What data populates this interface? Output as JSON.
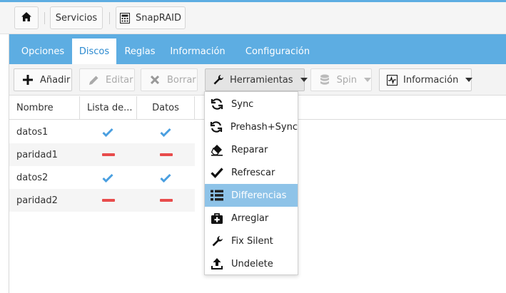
{
  "breadcrumb": {
    "home_icon": "home-icon",
    "items": [
      {
        "label": "Servicios"
      },
      {
        "label": "SnapRAID",
        "icon": "calculator-icon"
      }
    ]
  },
  "tabs": [
    {
      "label": "Opciones",
      "active": false
    },
    {
      "label": "Discos",
      "active": true
    },
    {
      "label": "Reglas",
      "active": false
    },
    {
      "label": "Información",
      "active": false
    },
    {
      "label": "Configuración",
      "active": false
    }
  ],
  "toolbar": {
    "add": {
      "label": "Añadir",
      "icon": "plus-icon",
      "disabled": false
    },
    "edit": {
      "label": "Editar",
      "icon": "pencil-icon",
      "disabled": true
    },
    "delete": {
      "label": "Borrar",
      "icon": "times-icon",
      "disabled": true
    },
    "tools": {
      "label": "Herramientas",
      "icon": "wrench-icon",
      "open": true
    },
    "spin": {
      "label": "Spin",
      "icon": "database-icon",
      "disabled": true
    },
    "info": {
      "label": "Información",
      "icon": "heartbeat-icon",
      "disabled": false
    }
  },
  "table": {
    "columns": [
      "Nombre",
      "Lista de...",
      "Datos"
    ],
    "rows": [
      {
        "name": "datos1",
        "list": true,
        "data": true
      },
      {
        "name": "paridad1",
        "list": false,
        "data": false
      },
      {
        "name": "datos2",
        "list": true,
        "data": true
      },
      {
        "name": "paridad2",
        "list": false,
        "data": false
      }
    ]
  },
  "menu": {
    "items": [
      {
        "label": "Sync",
        "icon": "refresh-icon"
      },
      {
        "label": "Prehash+Sync",
        "icon": "refresh-icon"
      },
      {
        "label": "Reparar",
        "icon": "eraser-icon"
      },
      {
        "label": "Refrescar",
        "icon": "check-icon"
      },
      {
        "label": "Differencias",
        "icon": "list-icon",
        "highlighted": true
      },
      {
        "label": "Arreglar",
        "icon": "medkit-icon"
      },
      {
        "label": "Fix Silent",
        "icon": "wrench-icon"
      },
      {
        "label": "Undelete",
        "icon": "upload-icon"
      }
    ]
  },
  "colors": {
    "accent": "#5dade2",
    "check": "#4a9fe0",
    "dash": "#e84c4c",
    "menu_highlight": "#8ec3e8"
  }
}
